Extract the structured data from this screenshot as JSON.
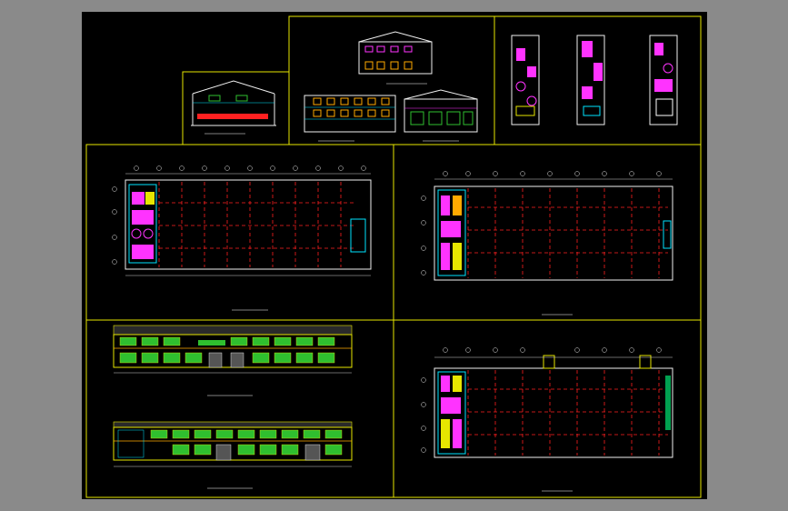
{
  "drawing": {
    "panels": {
      "section_small": {
        "caption": ""
      },
      "elevations_top": {
        "caption_1": "",
        "caption_2": "",
        "caption_3": ""
      },
      "floor_plan_1": {
        "caption": ""
      },
      "floor_plan_2": {
        "caption": ""
      },
      "floor_plan_3": {
        "caption": ""
      },
      "elevation_south": {
        "caption": ""
      },
      "elevation_north": {
        "caption": ""
      },
      "stair_details": {
        "caption_a": "",
        "caption_b": "",
        "caption_c": ""
      }
    },
    "colors": {
      "frame": "#e6e600",
      "grid": "#ff2020",
      "wall": "#f0f0f0",
      "room_fill": "#ff33ff",
      "window": "#2fbf2f",
      "accent": "#00e5ff"
    }
  }
}
